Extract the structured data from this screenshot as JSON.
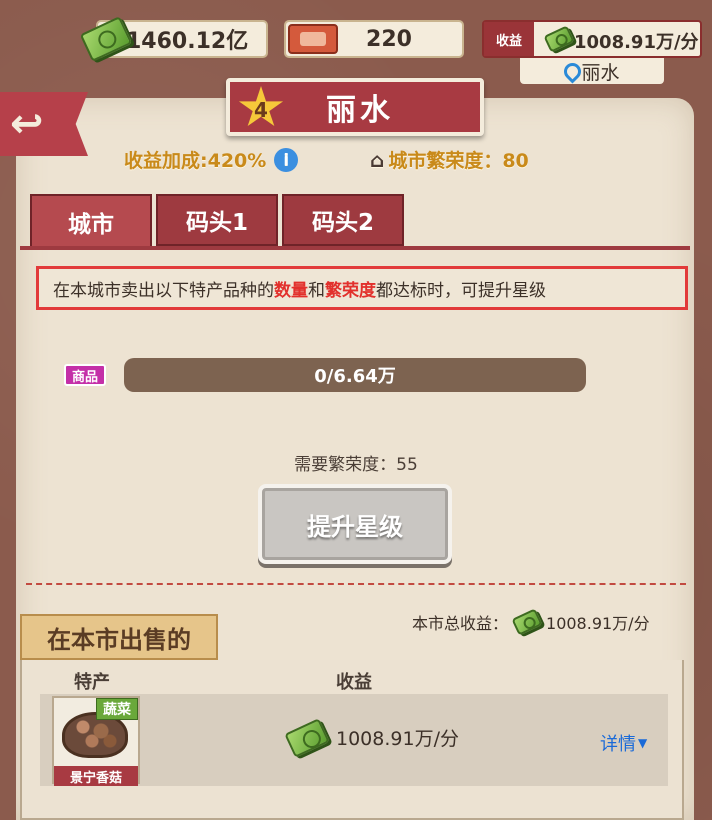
{
  "top_bar": {
    "money": "1460.12亿",
    "tickets": "220",
    "income_label": "收益",
    "income_value": "1008.91万/分",
    "location": "丽水"
  },
  "city": {
    "star_level": "4",
    "name": "丽水",
    "income_bonus": "收益加成:420%",
    "prosperity": "城市繁荣度：80"
  },
  "tabs": [
    {
      "label": "城市",
      "active": true
    },
    {
      "label": "码头1",
      "active": false
    },
    {
      "label": "码头2",
      "active": false
    }
  ],
  "notice": {
    "part1": "在本城市卖出以下特产品种的",
    "hl1": "数量",
    "part2": "和",
    "hl2": "繁荣度",
    "part3": "都达标时，可提升星级"
  },
  "requirement": {
    "tag": "商品",
    "progress_text": "0/6.64万",
    "progress_fraction": 0,
    "prosperity_needed": "需要繁荣度：55"
  },
  "upgrade_button": "提升星级",
  "selling": {
    "header": "在本市出售的",
    "total_label": "本市总收益：",
    "total_value": "1008.91万/分",
    "col_specialty": "特产",
    "col_income": "收益",
    "items": [
      {
        "category": "蔬菜",
        "name": "景宁香菇",
        "income": "1008.91万/分",
        "details": "详情"
      }
    ]
  },
  "colors": {
    "accent_red": "#a83a42",
    "notice_border": "#e23a3a",
    "gold_text": "#c98a1a",
    "link_blue": "#1a6ad8"
  }
}
